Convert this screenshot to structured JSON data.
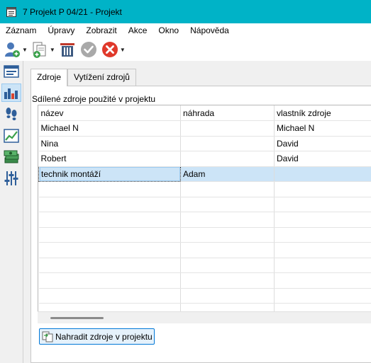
{
  "window": {
    "title": "7 Projekt P 04/21 - Projekt"
  },
  "menu": [
    "Záznam",
    "Úpravy",
    "Zobrazit",
    "Akce",
    "Okno",
    "Nápověda"
  ],
  "toolbar": {
    "icons": [
      "add-resource-icon",
      "copy-icon",
      "delete-icon",
      "confirm-icon",
      "cancel-icon"
    ]
  },
  "leftbar": {
    "icons": [
      "form-view-icon",
      "resources-chart-icon",
      "footsteps-icon",
      "trend-chart-icon",
      "money-icon",
      "sliders-icon"
    ],
    "active_index": 1
  },
  "tabs": [
    {
      "label": "Zdroje",
      "active": true
    },
    {
      "label": "Vytížení zdrojů",
      "active": false
    }
  ],
  "group_label": "Sdílené zdroje použité v projektu",
  "grid": {
    "columns": [
      "název",
      "náhrada",
      "vlastník zdroje"
    ],
    "rows": [
      [
        "Michael N",
        "",
        "Michael N"
      ],
      [
        "Nina",
        "",
        "David"
      ],
      [
        "Robert",
        "",
        "David"
      ],
      [
        "technik montáží",
        "Adam",
        ""
      ]
    ],
    "selected_row": 3
  },
  "replace_button": {
    "label": "Nahradit zdroje v projektu"
  },
  "colors": {
    "titlebar": "#00b3c7",
    "selection": "#cce4f7",
    "button_border": "#0078d7",
    "cancel_red": "#e0392b"
  }
}
